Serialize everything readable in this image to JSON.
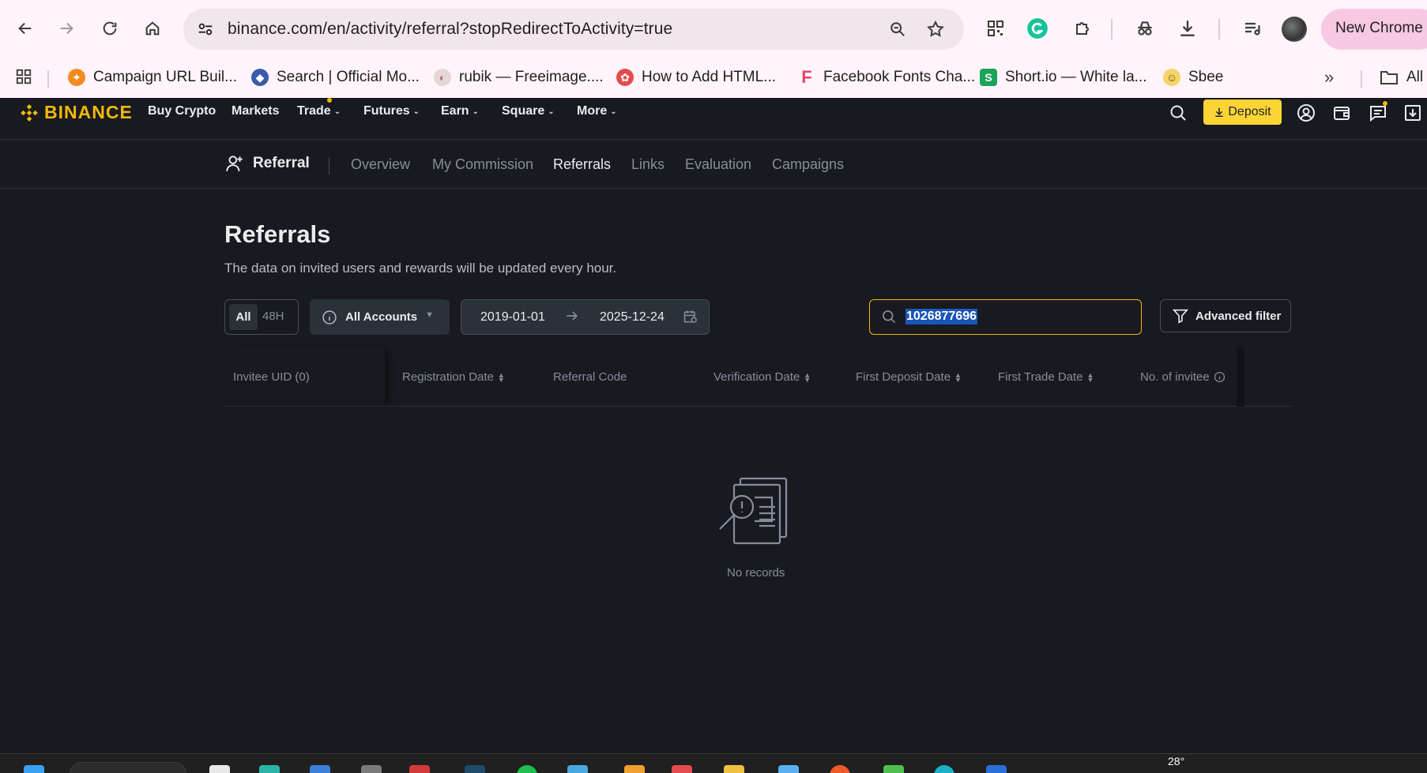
{
  "browser": {
    "url": "binance.com/en/activity/referral?stopRedirectToActivity=true",
    "new_chrome_label": "New Chrome a",
    "bookmarks": [
      {
        "label": "Campaign URL Buil...",
        "icon": "campaign-favicon",
        "color": "#f28b20"
      },
      {
        "label": "Search | Official Mo...",
        "icon": "search-favicon",
        "color": "#3b5ba9"
      },
      {
        "label": "rubik — Freeimage....",
        "icon": "rubik-favicon",
        "color": "#c48a8a"
      },
      {
        "label": "How to Add HTML...",
        "icon": "html-favicon",
        "color": "#e24c4c"
      },
      {
        "label": "Facebook Fonts Cha...",
        "icon": "fonts-favicon",
        "color": "#e9446a"
      },
      {
        "label": "Short.io — White la...",
        "icon": "shortio-favicon",
        "color": "#1aa35a"
      },
      {
        "label": "Sbee",
        "icon": "sbee-favicon",
        "color": "#e9b200"
      }
    ],
    "all_bookmarks_label": "All"
  },
  "nav": {
    "logo": "BINANCE",
    "items": [
      {
        "label": "Buy Crypto",
        "dropdown": false
      },
      {
        "label": "Markets",
        "dropdown": false
      },
      {
        "label": "Trade",
        "dropdown": true
      },
      {
        "label": "Futures",
        "dropdown": true
      },
      {
        "label": "Earn",
        "dropdown": true
      },
      {
        "label": "Square",
        "dropdown": true
      },
      {
        "label": "More",
        "dropdown": true
      }
    ],
    "deposit_label": "Deposit"
  },
  "subnav": {
    "brand": "Referral",
    "tabs": [
      "Overview",
      "My Commission",
      "Referrals",
      "Links",
      "Evaluation",
      "Campaigns"
    ],
    "active_tab": "Referrals"
  },
  "page": {
    "title": "Referrals",
    "subtitle": "The data on invited users and rewards will be updated every hour."
  },
  "filters": {
    "period_all": "All",
    "period_48h": "48H",
    "accounts_label": "All Accounts",
    "date_start": "2019-01-01",
    "date_end": "2025-12-24",
    "search_value": "1026877696",
    "advanced_label": "Advanced filter"
  },
  "table": {
    "columns": [
      {
        "label": "Invitee UID (0)",
        "sortable": false
      },
      {
        "label": "Registration Date",
        "sortable": true
      },
      {
        "label": "Referral Code",
        "sortable": false
      },
      {
        "label": "Verification Date",
        "sortable": true
      },
      {
        "label": "First Deposit Date",
        "sortable": true
      },
      {
        "label": "First Trade Date",
        "sortable": true
      },
      {
        "label": "No. of invitee",
        "sortable": false,
        "info": true
      }
    ],
    "rows": [],
    "empty_text": "No records"
  },
  "taskbar": {
    "temperature": "28°"
  },
  "colors": {
    "brand_yellow": "#f0b90b",
    "deposit_bg": "#fcd535",
    "page_bg": "#181a20",
    "panel_bg": "#2b3139",
    "text_primary": "#eaecef",
    "text_secondary": "#848e9c",
    "selection": "#1a56b8"
  }
}
